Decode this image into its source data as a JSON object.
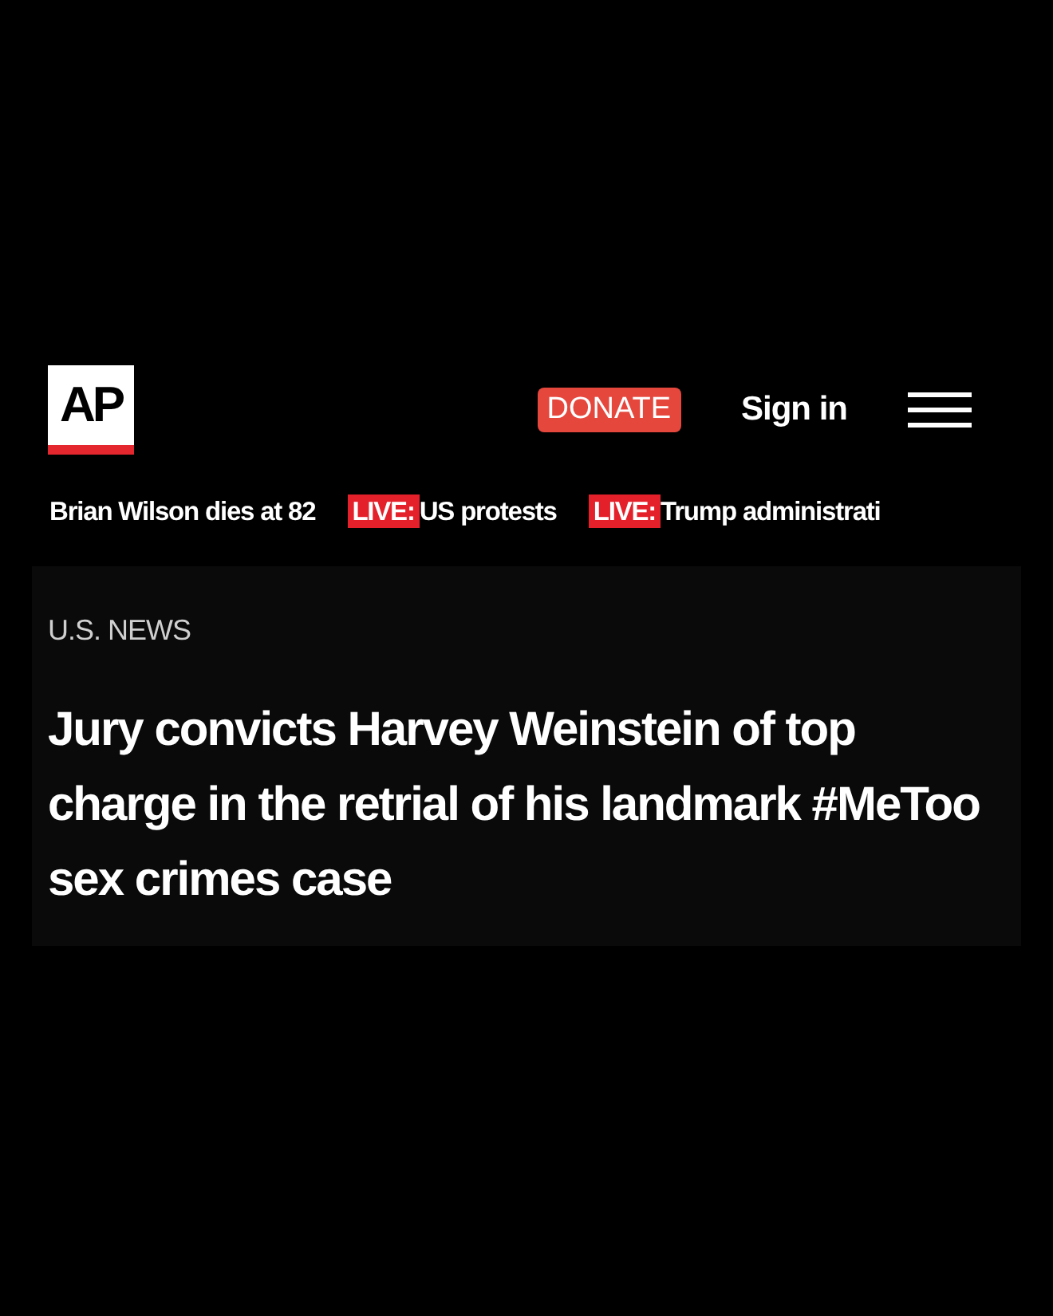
{
  "header": {
    "logo": "AP",
    "donate": "DONATE",
    "sign_in": "Sign in"
  },
  "ticker": [
    {
      "kind": "plain",
      "text": "Brian Wilson dies at 82"
    },
    {
      "kind": "live",
      "badge": "LIVE:",
      "text": "US protests"
    },
    {
      "kind": "live",
      "badge": "LIVE:",
      "text": "Trump administrati"
    }
  ],
  "article": {
    "section": "U.S. NEWS",
    "headline": "Jury convicts Harvey Weinstein of top charge in the retrial of his landmark #MeToo sex crimes case"
  }
}
